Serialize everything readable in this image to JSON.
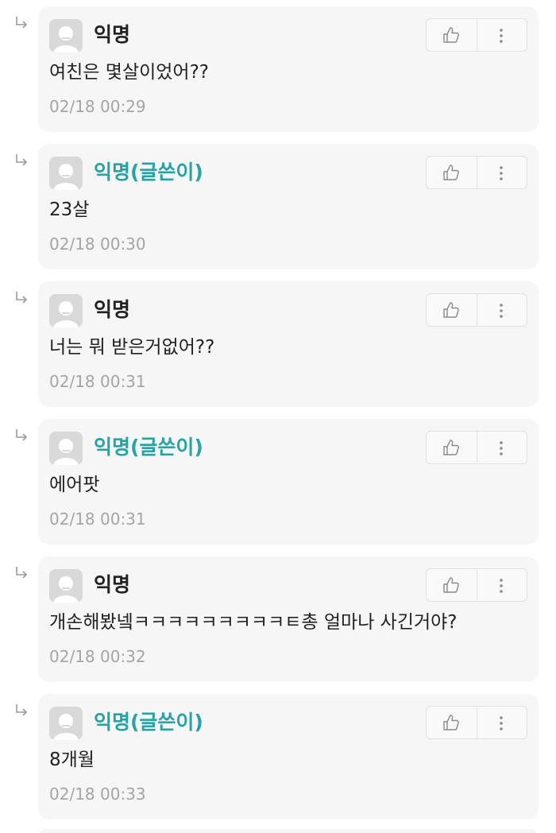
{
  "comments": [
    {
      "author": "익명",
      "is_op": false,
      "text": "여친은 몇살이었어??",
      "time": "02/18 00:29"
    },
    {
      "author": "익명(글쓴이)",
      "is_op": true,
      "text": "23살",
      "time": "02/18 00:30"
    },
    {
      "author": "익명",
      "is_op": false,
      "text": "너는 뭐 받은거없어??",
      "time": "02/18 00:31"
    },
    {
      "author": "익명(글쓴이)",
      "is_op": true,
      "text": "에어팟",
      "time": "02/18 00:31"
    },
    {
      "author": "익명",
      "is_op": false,
      "text": "개손해봤넼ㅋㅋㅋㅋㅋㅋㅋㅋㅋㅌ총 얼마나 사긴거야?",
      "time": "02/18 00:32"
    },
    {
      "author": "익명(글쓴이)",
      "is_op": true,
      "text": "8개월",
      "time": "02/18 00:33"
    }
  ],
  "colors": {
    "card_background": "#f6f6f6",
    "op_author": "#27a2a5",
    "author": "#222222",
    "timestamp": "#a5a5a5"
  },
  "icons": {
    "reply": "reply-arrow-icon",
    "avatar": "default-avatar-icon",
    "like": "thumbs-up-icon",
    "more": "more-vertical-icon"
  }
}
